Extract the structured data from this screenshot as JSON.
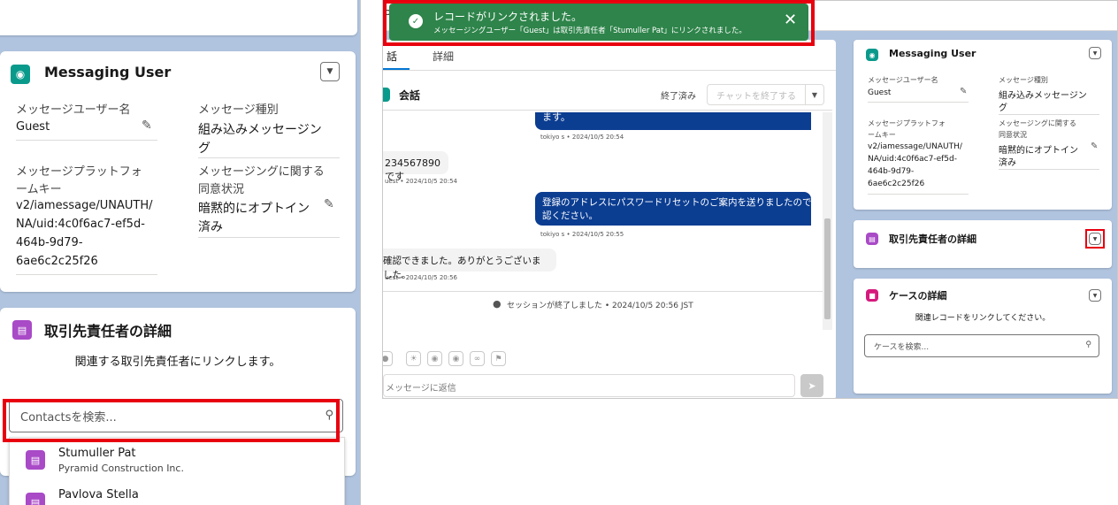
{
  "left": {
    "messaging_user": {
      "title": "Messaging User",
      "username_label": "メッセージユーザー名",
      "username_value": "Guest",
      "type_label": "メッセージ種別",
      "type_value_1": "組み込みメッセージン",
      "type_value_2": "グ",
      "platform_label_1": "メッセージプラットフォ",
      "platform_label_2": "ームキー",
      "platform_value_1": "v2/iamessage/UNAUTH/",
      "platform_value_2": "NA/uid:4c0f6ac7-ef5d-",
      "platform_value_3": "464b-9d79-",
      "platform_value_4": "6ae6c2c25f26",
      "consent_label_1": "メッセージングに関する",
      "consent_label_2": "同意状況",
      "consent_value_1": "暗黙的にオプトイン",
      "consent_value_2": "済み"
    },
    "contact_details": {
      "title": "取引先責任者の詳細",
      "subtitle": "関連する取引先責任者にリンクします。",
      "search_placeholder": "Contactsを検索..."
    },
    "dropdown": [
      {
        "name": "Stumuller Pat",
        "company": "Pyramid Construction Inc."
      },
      {
        "name": "Pavlova Stella",
        "company": ""
      }
    ]
  },
  "right": {
    "toast": {
      "title": "レコードがリンクされました。",
      "message": "メッセージングユーザー「Guest」は取引先責任者「Stumuller Pat」にリンクされました。"
    },
    "header_partial": "o",
    "tabs": [
      {
        "label": "話",
        "active": true
      },
      {
        "label": "詳細",
        "active": false
      }
    ],
    "conversation": {
      "title": "会話",
      "status": "終了済み",
      "end_chat_button": "チャットを終了する",
      "messages": [
        {
          "dir": "out",
          "text": "ます。",
          "meta": "tokiyo s • 2024/10/5 20:54"
        },
        {
          "dir": "in",
          "text": "234567890です",
          "meta": "uest • 2024/10/5 20:54"
        },
        {
          "dir": "out",
          "text1": "登録のアドレスにパスワードリセットのご案内を送りましたのでご確",
          "text2": "認ください。",
          "meta": "tokiyo s • 2024/10/5 20:55"
        },
        {
          "dir": "in",
          "text": "確認できました。ありがとうございました。",
          "meta": "uest • 2024/10/5 20:56"
        }
      ],
      "session_ended": "セッションが終了しました • 2024/10/5 20:56 JST",
      "reply_placeholder": "メッセージに返信"
    },
    "messaging_user": {
      "title": "Messaging User",
      "username_label": "メッセージユーザー名",
      "username_value": "Guest",
      "type_label": "メッセージ種別",
      "type_value_1": "組み込みメッセージン",
      "type_value_2": "グ",
      "platform_label_1": "メッセージプラットフォ",
      "platform_label_2": "ームキー",
      "platform_value_1": "v2/iamessage/UNAUTH/",
      "platform_value_2": "NA/uid:4c0f6ac7-ef5d-",
      "platform_value_3": "464b-9d79-",
      "platform_value_4": "6ae6c2c25f26",
      "consent_label_1": "メッセージングに関する",
      "consent_label_2": "同意状況",
      "consent_value_1": "暗黙的にオプトイン",
      "consent_value_2": "済み"
    },
    "contact_details": {
      "title": "取引先責任者の詳細"
    },
    "case_details": {
      "title": "ケースの詳細",
      "subtitle": "関連レコードをリンクしてください。",
      "search_placeholder": "ケースを検索..."
    }
  },
  "colors": {
    "accent_red": "#e8000f",
    "toast_green": "#2e844a",
    "bubble_blue": "#0b3d91",
    "contact_purple": "#a94ac7",
    "case_pink": "#d6197e",
    "messaging_teal": "#0a9a8c"
  }
}
